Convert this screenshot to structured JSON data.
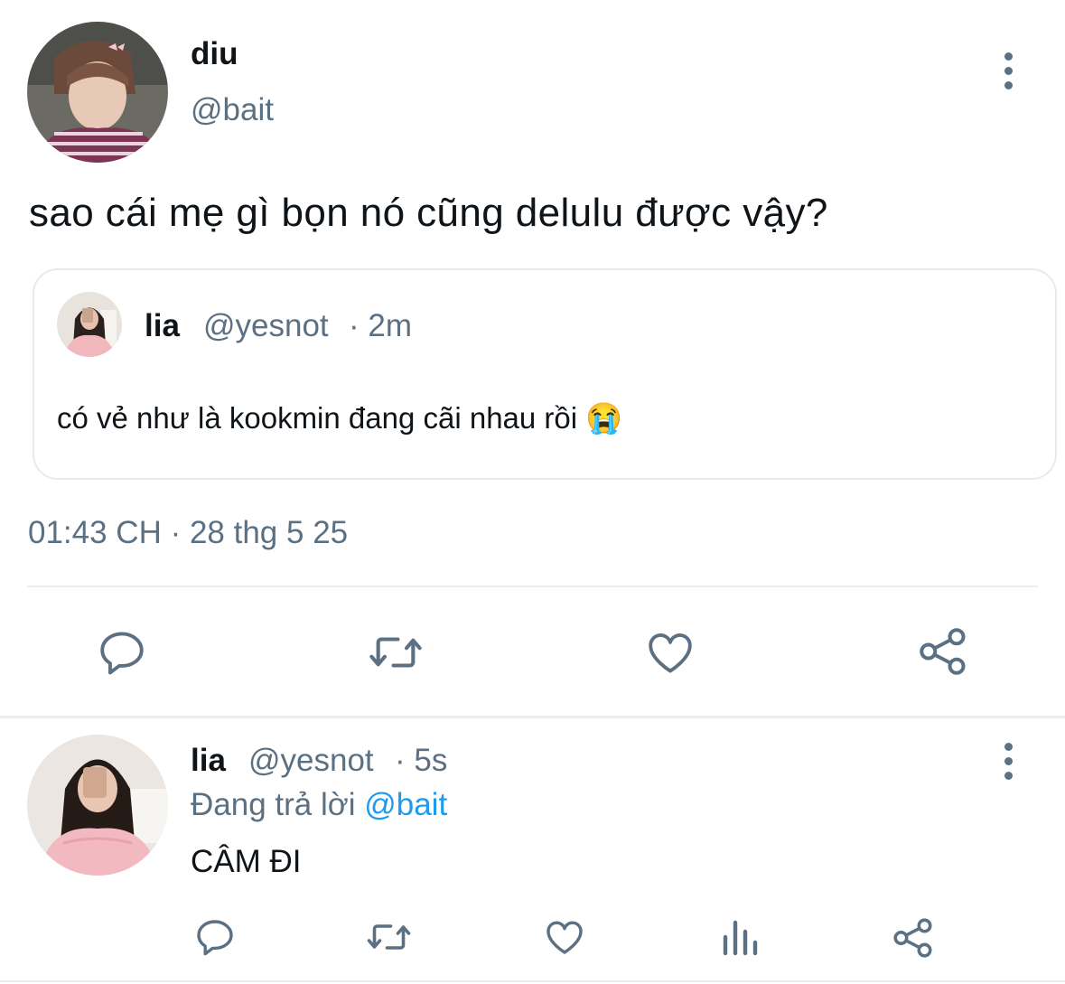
{
  "main_tweet": {
    "display_name": "diu",
    "handle": "@bait",
    "text": "sao cái mẹ gì bọn nó cũng delulu được vậy?",
    "timestamp": "01:43 CH · 28 thg 5 25",
    "quoted": {
      "display_name": "lia",
      "handle": "@yesnot",
      "time": "· 2m",
      "text": "có vẻ như là kookmin đang cãi nhau rồi 😭"
    },
    "actions": [
      "reply-icon",
      "retweet-icon",
      "like-icon",
      "share-icon"
    ]
  },
  "reply": {
    "display_name": "lia",
    "handle": "@yesnot",
    "time": "· 5s",
    "replying_prefix": "Đang trả lời",
    "replying_to": "@bait",
    "text": "CÂM ĐI",
    "actions": [
      "reply-icon",
      "retweet-icon",
      "like-icon",
      "views-icon",
      "share-icon"
    ]
  },
  "colors": {
    "secondary_text": "#5b7083",
    "link": "#1d9bf0",
    "divider": "#e9edf0",
    "icon": "#5b7083"
  }
}
